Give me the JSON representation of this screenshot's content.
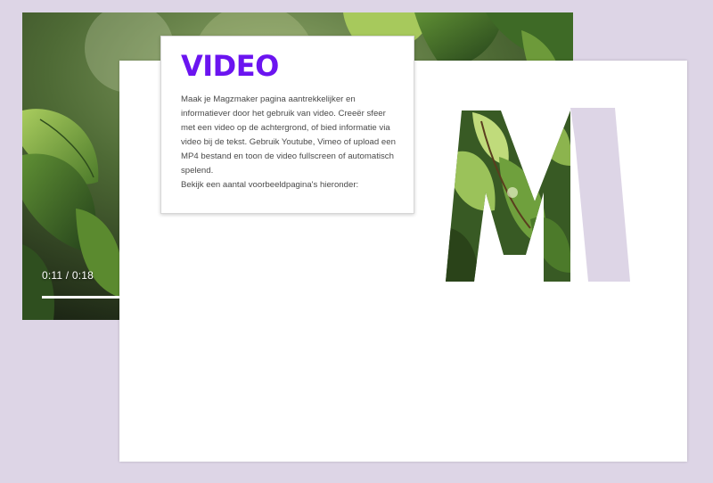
{
  "video": {
    "time": "0:11 / 0:18",
    "progress": 0.61
  },
  "card": {
    "title": "VIDEO",
    "body": "Maak je Magzmaker pagina aantrekkelijker en informatiever door het gebruik van video. Creeër sfeer met een video op de achtergrond, of bied informatie via video bij de tekst. Gebruik Youtube, Vimeo of upload een MP4 bestand en toon de video fullscreen of automatisch spelend.\nBekijk een aantal voorbeeldpagina's hieronder:"
  },
  "letter": {
    "char": "M"
  },
  "colors": {
    "accent": "#6b14f0",
    "background": "#ddd5e6",
    "letter_tint": "#ddd5e6"
  }
}
